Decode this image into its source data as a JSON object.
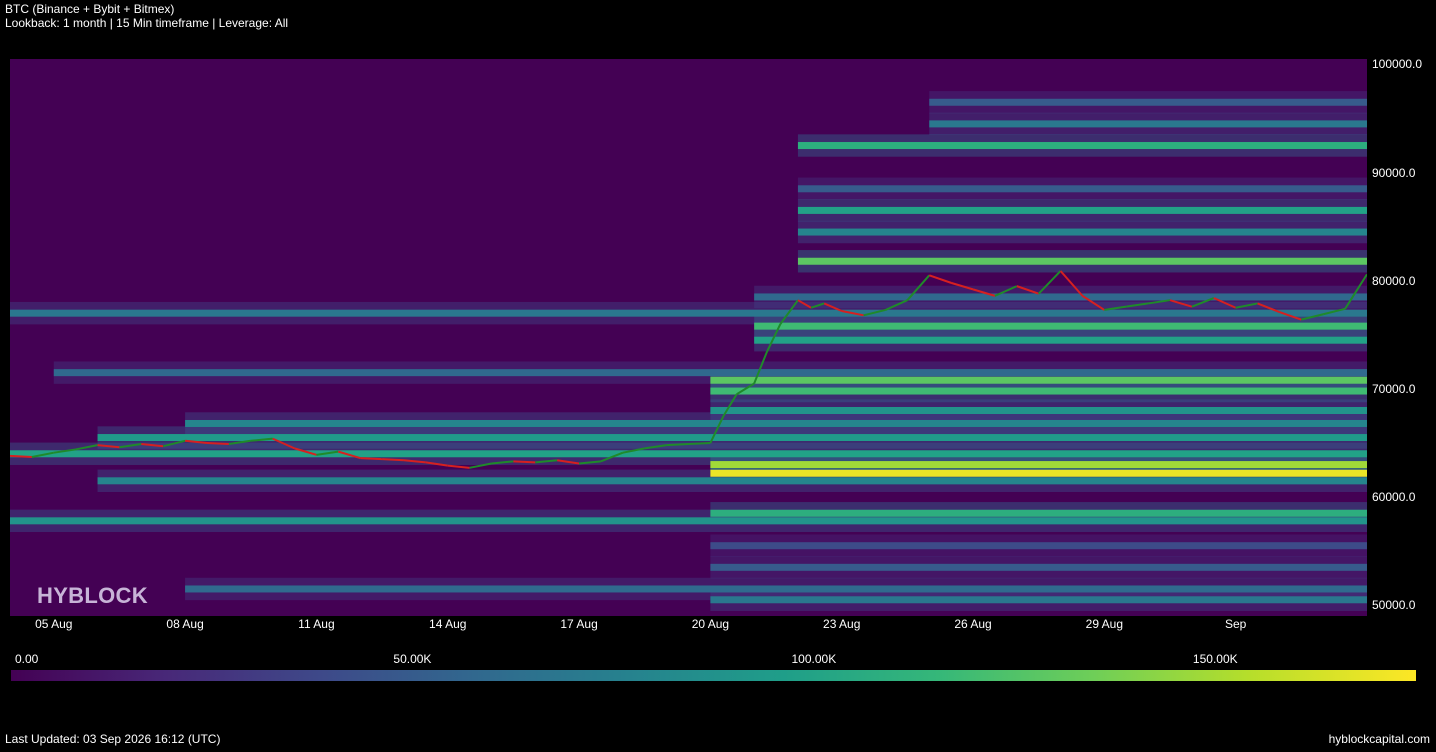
{
  "header": {
    "title": "BTC (Binance + Bybit + Bitmex)",
    "subtitle": "Lookback: 1 month | 15 Min timeframe | Leverage: All"
  },
  "watermark": "HYBLOCK",
  "footer": {
    "updated": "Last Updated: 03 Sep 2026 16:12 (UTC)",
    "site": "hyblockcapital.com"
  },
  "colors": {
    "background": "#000000",
    "plot_background": "#440154",
    "price_up": "#1f8a2a",
    "price_down": "#d62020",
    "colormap": [
      "#440154",
      "#482878",
      "#3e4989",
      "#31688e",
      "#26828e",
      "#1f9e89",
      "#35b779",
      "#6ece58",
      "#b5de2b",
      "#fde725"
    ]
  },
  "chart_data": {
    "type": "heatmap",
    "title": "BTC (Binance + Bybit + Bitmex)",
    "y_range": [
      49000,
      100500
    ],
    "x_range": [
      0,
      31
    ],
    "y_ticks": [
      {
        "label": "100000.0",
        "value": 100000
      },
      {
        "label": "90000.0",
        "value": 90000
      },
      {
        "label": "80000.0",
        "value": 80000
      },
      {
        "label": "70000.0",
        "value": 70000
      },
      {
        "label": "60000.0",
        "value": 60000
      },
      {
        "label": "50000.0",
        "value": 50000
      }
    ],
    "x_ticks": [
      {
        "label": "05 Aug",
        "day": 1
      },
      {
        "label": "08 Aug",
        "day": 4
      },
      {
        "label": "11 Aug",
        "day": 7
      },
      {
        "label": "14 Aug",
        "day": 10
      },
      {
        "label": "17 Aug",
        "day": 13
      },
      {
        "label": "20 Aug",
        "day": 16
      },
      {
        "label": "23 Aug",
        "day": 19
      },
      {
        "label": "26 Aug",
        "day": 22
      },
      {
        "label": "29 Aug",
        "day": 25
      },
      {
        "label": "Sep",
        "day": 28
      }
    ],
    "colorbar": {
      "min": 0,
      "max": 175000,
      "ticks": [
        {
          "label": "0.00",
          "value": 0
        },
        {
          "label": "50.00K",
          "value": 50000
        },
        {
          "label": "100.00K",
          "value": 100000
        },
        {
          "label": "150.00K",
          "value": 150000
        }
      ]
    },
    "liquidation_bands": [
      {
        "price": 51500,
        "start_day": 4,
        "end_day": 31,
        "value": 60000
      },
      {
        "price": 50500,
        "start_day": 16,
        "end_day": 31,
        "value": 70000
      },
      {
        "price": 53500,
        "start_day": 16,
        "end_day": 31,
        "value": 50000
      },
      {
        "price": 55500,
        "start_day": 16,
        "end_day": 31,
        "value": 40000
      },
      {
        "price": 57800,
        "start_day": 0,
        "end_day": 31,
        "value": 90000
      },
      {
        "price": 58500,
        "start_day": 16,
        "end_day": 31,
        "value": 110000
      },
      {
        "price": 61500,
        "start_day": 2,
        "end_day": 31,
        "value": 80000
      },
      {
        "price": 62200,
        "start_day": 16,
        "end_day": 31,
        "value": 170000
      },
      {
        "price": 63000,
        "start_day": 16,
        "end_day": 31,
        "value": 150000
      },
      {
        "price": 64000,
        "start_day": 0,
        "end_day": 31,
        "value": 100000
      },
      {
        "price": 65500,
        "start_day": 2,
        "end_day": 31,
        "value": 95000
      },
      {
        "price": 66800,
        "start_day": 4,
        "end_day": 31,
        "value": 80000
      },
      {
        "price": 68000,
        "start_day": 16,
        "end_day": 31,
        "value": 90000
      },
      {
        "price": 69800,
        "start_day": 16,
        "end_day": 31,
        "value": 120000
      },
      {
        "price": 70800,
        "start_day": 16,
        "end_day": 31,
        "value": 130000
      },
      {
        "price": 71500,
        "start_day": 1,
        "end_day": 31,
        "value": 60000
      },
      {
        "price": 74500,
        "start_day": 17,
        "end_day": 31,
        "value": 100000
      },
      {
        "price": 75800,
        "start_day": 17,
        "end_day": 31,
        "value": 120000
      },
      {
        "price": 77000,
        "start_day": 0,
        "end_day": 31,
        "value": 70000
      },
      {
        "price": 78500,
        "start_day": 17,
        "end_day": 31,
        "value": 60000
      },
      {
        "price": 81800,
        "start_day": 18,
        "end_day": 31,
        "value": 130000
      },
      {
        "price": 84500,
        "start_day": 18,
        "end_day": 31,
        "value": 80000
      },
      {
        "price": 86500,
        "start_day": 18,
        "end_day": 31,
        "value": 100000
      },
      {
        "price": 88500,
        "start_day": 18,
        "end_day": 31,
        "value": 50000
      },
      {
        "price": 92500,
        "start_day": 18,
        "end_day": 31,
        "value": 110000
      },
      {
        "price": 94500,
        "start_day": 21,
        "end_day": 31,
        "value": 70000
      },
      {
        "price": 96500,
        "start_day": 21,
        "end_day": 31,
        "value": 50000
      }
    ],
    "price": {
      "x_days": [
        0,
        0.5,
        1,
        1.5,
        2,
        2.5,
        3,
        3.5,
        4,
        4.5,
        5,
        5.5,
        6,
        6.5,
        7,
        7.5,
        8,
        8.5,
        9,
        9.5,
        10,
        10.5,
        11,
        11.5,
        12,
        12.5,
        13,
        13.5,
        14,
        14.5,
        15,
        15.5,
        16,
        16.3,
        16.6,
        17,
        17.3,
        17.6,
        18,
        18.3,
        18.6,
        19,
        19.5,
        20,
        20.5,
        21,
        21.5,
        22,
        22.5,
        23,
        23.5,
        24,
        24.5,
        25,
        25.5,
        26,
        26.5,
        27,
        27.5,
        28,
        28.5,
        29,
        29.5,
        30,
        30.5,
        31
      ],
      "values": [
        63800,
        63700,
        64100,
        64400,
        64800,
        64600,
        64900,
        64700,
        65200,
        65000,
        64900,
        65200,
        65400,
        64500,
        63900,
        64200,
        63600,
        63500,
        63400,
        63200,
        62900,
        62700,
        63100,
        63300,
        63200,
        63400,
        63100,
        63300,
        64100,
        64500,
        64800,
        64900,
        65000,
        67500,
        69500,
        70500,
        73500,
        76000,
        78200,
        77500,
        77900,
        77200,
        76800,
        77300,
        78200,
        80500,
        79800,
        79200,
        78600,
        79500,
        78800,
        80900,
        78600,
        77300,
        77600,
        77900,
        78200,
        77600,
        78400,
        77500,
        77900,
        77100,
        76400,
        76900,
        77400,
        80600
      ]
    }
  }
}
